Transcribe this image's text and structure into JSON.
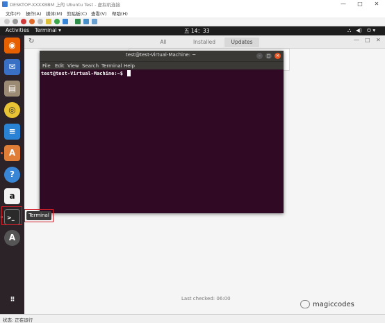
{
  "host_window": {
    "title": "DESKTOP-XXXXBBM 上的 Ubuntu Test - 虚拟机连接",
    "menu": [
      "文件(F)",
      "操作(A)",
      "媒体(M)",
      "剪贴板(C)",
      "查看(V)",
      "帮助(H)"
    ],
    "status": "状态: 正在运行"
  },
  "top_bar": {
    "activities": "Activities",
    "app_menu": "Terminal ▾",
    "clock": "五 14：33",
    "tray": [
      "⛬",
      "◀)",
      "⏻ ▾"
    ]
  },
  "dock": {
    "items": [
      {
        "name": "firefox",
        "glyph": "🦊",
        "color": "#e66000"
      },
      {
        "name": "thunderbird",
        "glyph": "✉",
        "color": "#3a70c4"
      },
      {
        "name": "files",
        "glyph": "▤",
        "color": "#9b8a74"
      },
      {
        "name": "rhythmbox",
        "glyph": "◎",
        "color": "#e8c334"
      },
      {
        "name": "libreoffice-writer",
        "glyph": "≡",
        "color": "#2a82d4"
      },
      {
        "name": "ubuntu-software",
        "glyph": "A",
        "color": "#e07d36"
      },
      {
        "name": "help",
        "glyph": "?",
        "color": "#3a86d6"
      },
      {
        "name": "amazon",
        "glyph": "a",
        "color": "#f2f2f2"
      },
      {
        "name": "terminal",
        "glyph": ">_",
        "color": "#2a2a2a"
      },
      {
        "name": "software-updater",
        "glyph": "A",
        "color": "#555555"
      }
    ],
    "show_apps_glyph": "⋮⋮⋮"
  },
  "software": {
    "tabs": [
      "All",
      "Installed",
      "Updates"
    ],
    "active_tab": "Updates",
    "last_checked": "Last checked: 06:00"
  },
  "terminal": {
    "title": "test@test-Virtual-Machine: ~",
    "menu": [
      "File",
      "Edit",
      "View",
      "Search",
      "Terminal",
      "Help"
    ],
    "prompt": "test@test-Virtual-Machine:~$",
    "background": "#300a24"
  },
  "tooltip": {
    "label": "Terminal"
  },
  "watermark": {
    "text": "magiccodes"
  }
}
